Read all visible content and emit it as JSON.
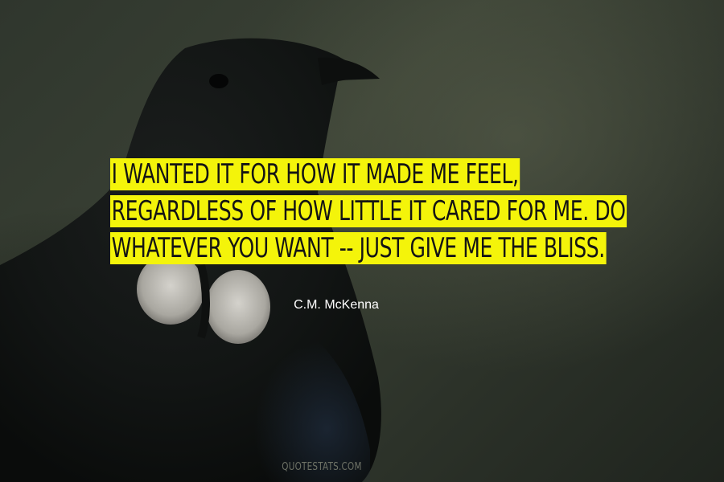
{
  "quote": {
    "lines": [
      "I WANTED IT FOR HOW IT MADE ME FEEL,",
      "REGARDLESS OF HOW LITTLE IT CARED FOR ME. DO",
      "WHATEVER YOU WANT -- JUST GIVE ME THE BLISS."
    ],
    "highlight_color": "#f4f40a",
    "text_color": "#141414"
  },
  "author": "C.M. McKenna",
  "footer": "QUOTESTATS.COM",
  "background": {
    "image_subject": "black-bird-silhouette-icon"
  }
}
